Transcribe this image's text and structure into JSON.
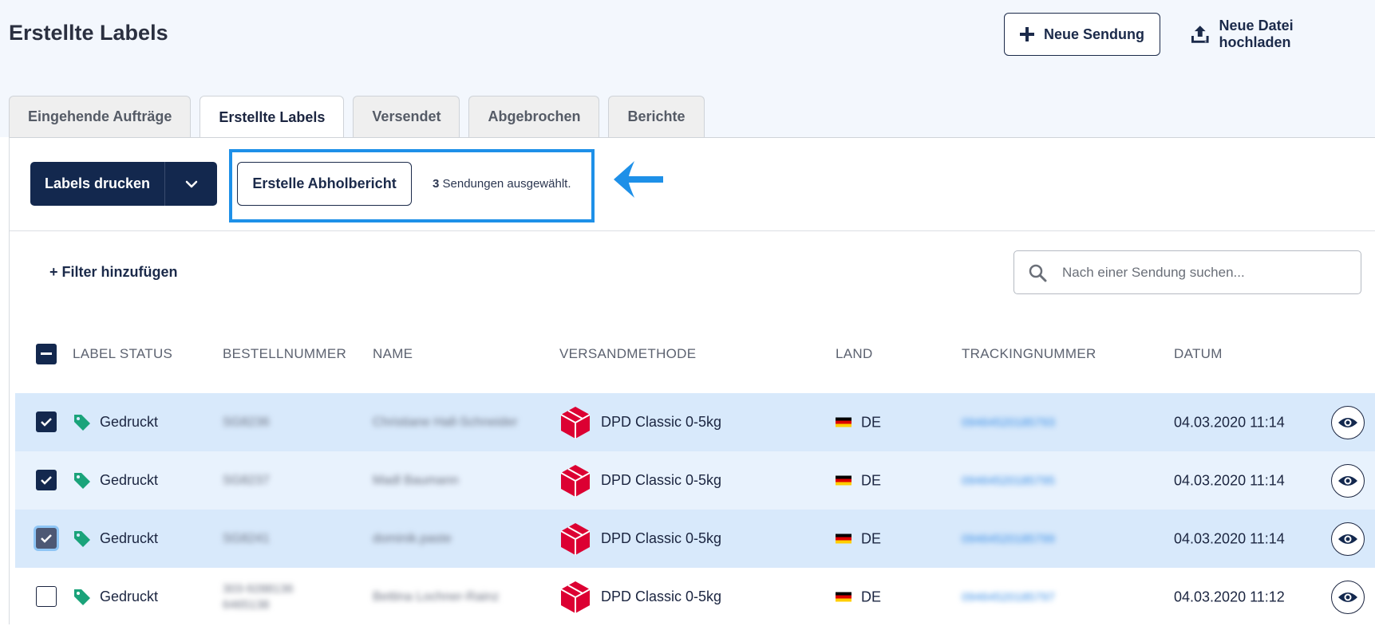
{
  "header": {
    "title": "Erstellte Labels",
    "new_shipment_label": "Neue Sendung",
    "upload_label": "Neue Datei hochladen"
  },
  "tabs": [
    {
      "label": "Eingehende Aufträge",
      "active": false
    },
    {
      "label": "Erstellte Labels",
      "active": true
    },
    {
      "label": "Versendet",
      "active": false
    },
    {
      "label": "Abgebrochen",
      "active": false
    },
    {
      "label": "Berichte",
      "active": false
    }
  ],
  "toolbar": {
    "print_label": "Labels drucken",
    "report_label": "Erstelle Abholbericht",
    "selected_count": "3",
    "selected_text": "Sendungen ausgewählt."
  },
  "filter": {
    "add_filter_label": "+ Filter hinzufügen",
    "search_placeholder": "Nach einer Sendung suchen..."
  },
  "table": {
    "columns": [
      "LABEL STATUS",
      "BESTELLNUMMER",
      "NAME",
      "VERSANDMETHODE",
      "LAND",
      "TRACKINGNUMMER",
      "DATUM"
    ],
    "rows": [
      {
        "checked": true,
        "status": "Gedruckt",
        "order": "SG8236",
        "name": "Christiane Hall-Schneider",
        "method": "DPD Classic 0-5kg",
        "country": "DE",
        "tracking": "09464520185793",
        "date": "04.03.2020 11:14"
      },
      {
        "checked": true,
        "status": "Gedruckt",
        "order": "SG8237",
        "name": "Madl Baumann",
        "method": "DPD Classic 0-5kg",
        "country": "DE",
        "tracking": "09464520185795",
        "date": "04.03.2020 11:14"
      },
      {
        "checked": true,
        "status": "Gedruckt",
        "order": "SG8241",
        "name": "dominik.paste",
        "method": "DPD Classic 0-5kg",
        "country": "DE",
        "tracking": "09464520185799",
        "date": "04.03.2020 11:14"
      },
      {
        "checked": false,
        "status": "Gedruckt",
        "order": "303-9288136 6465138",
        "name": "Bettina Lochner-Rainz",
        "method": "DPD Classic 0-5kg",
        "country": "DE",
        "tracking": "09464520185797",
        "date": "04.03.2020 11:12"
      }
    ]
  },
  "colors": {
    "primary": "#13284e",
    "highlight": "#1e90e8",
    "tag_green": "#1aa37a",
    "dpd_red": "#dc0032",
    "row_selected": "#d8e9fb"
  },
  "icons": {
    "plus": "plus-icon",
    "upload": "upload-icon",
    "caret": "chevron-down-icon",
    "arrow": "arrow-left-icon",
    "search": "search-icon",
    "tag": "tag-icon",
    "dpd": "dpd-logo-icon",
    "flag": "germany-flag-icon",
    "eye": "eye-icon"
  }
}
